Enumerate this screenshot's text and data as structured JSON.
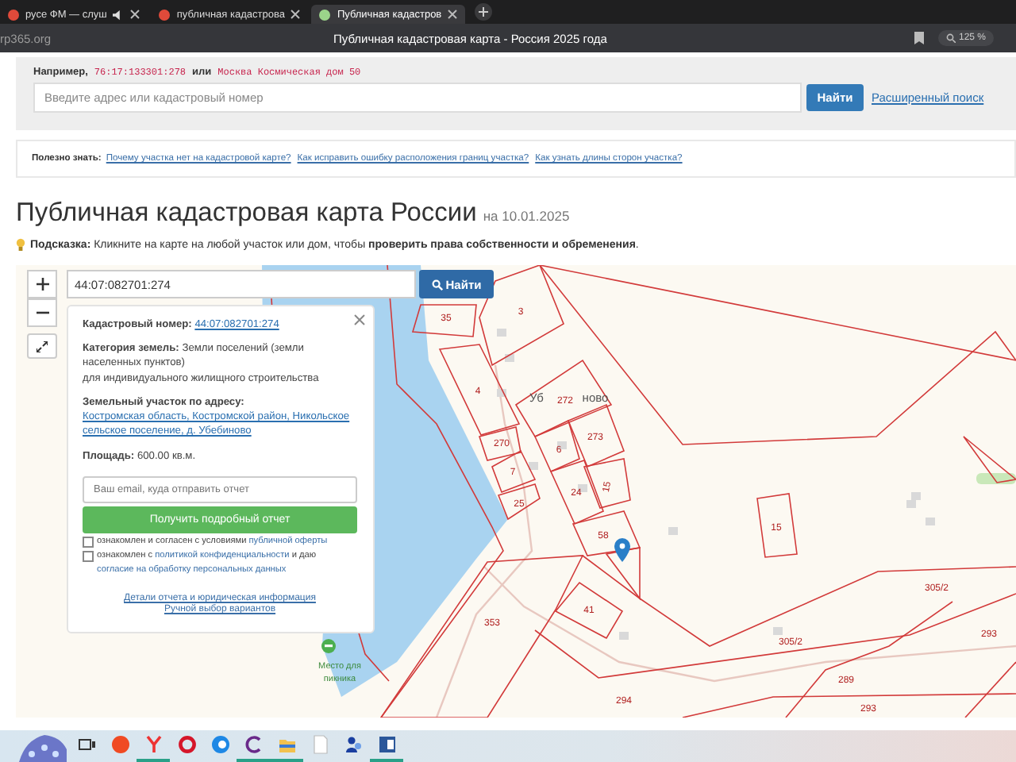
{
  "browser": {
    "tabs": [
      {
        "title": "русе ФМ — слуш",
        "audio": true,
        "selected": false
      },
      {
        "title": "публичная кадастрова",
        "audio": false,
        "selected": false
      },
      {
        "title": "Публичная кадастров",
        "audio": false,
        "selected": true
      }
    ],
    "address": "rp365.org",
    "page_title": "Публичная кадастровая карта - Россия 2025 года",
    "zoom": "125 %"
  },
  "search": {
    "example_label": "Например,",
    "example_1": "76:17:133301:278",
    "or": "или",
    "example_2": "Москва Космическая дом 50",
    "placeholder": "Введите адрес или кадастровый номер",
    "button": "Найти",
    "advanced_link": "Расширенный поиск"
  },
  "tips": {
    "label": "Полезно знать:",
    "links": [
      "Почему участка нет на кадастровой карте?",
      "Как исправить ошибку расположения границ участка?",
      "Как узнать длины сторон участка?"
    ]
  },
  "heading": {
    "title": "Публичная кадастровая карта России",
    "date": "на 10.01.2025"
  },
  "hint": "**Подсказка:** Кликните на карте на любой участок или дом, чтобы **проверить права собственности и обременения**.",
  "map": {
    "search_value": "44:07:082701:274",
    "search_button": "Найти",
    "parcel_labels": [
      "35",
      "3",
      "4",
      "272",
      "270",
      "273",
      "6",
      "7",
      "24",
      "15",
      "25",
      "58",
      "15",
      "305/2",
      "305/2",
      "353",
      "41",
      "293",
      "289",
      "293",
      "294"
    ],
    "village_label_parts": [
      "Уб",
      "ново"
    ],
    "poi_label": "Место для пикника",
    "popup": {
      "cadastral_label": "Кадастровый номер:",
      "cadastral_number": "44:07:082701:274",
      "category_label": "Категория земель:",
      "category": "Земли поселений (земли населенных пунктов)",
      "use": "для индивидуального жилищного строительства",
      "address_label": "Земельный участок по адресу:",
      "address": "Костромская область, Костромской район, Никольское сельское поселение, д. Убебиново",
      "area_label": "Площадь:",
      "area": "600.00 кв.м.",
      "email_placeholder": "Ваш email, куда отправить отчет",
      "report_button": "Получить подробный отчет",
      "consents": [
        {
          "checked": false,
          "parts": [
            {
              "kind": "plain",
              "text": "ознакомлен и согласен с условиями "
            },
            {
              "kind": "link",
              "text": "публичной оферты"
            }
          ]
        },
        {
          "checked": false,
          "parts": [
            {
              "kind": "plain",
              "text": "ознакомлен с "
            },
            {
              "kind": "link",
              "text": "политикой конфиденциальности"
            },
            {
              "kind": "plain",
              "text": " и даю "
            },
            {
              "kind": "link",
              "text": "согласие на обработку персональных данных"
            }
          ]
        }
      ],
      "links": [
        "Детали отчета и юридическая информация",
        "Ручной выбор вариантов"
      ]
    }
  },
  "taskbar": {
    "items": [
      {
        "kind": "task-view",
        "running": false
      },
      {
        "kind": "red-circle",
        "running": false
      },
      {
        "kind": "y-browser",
        "running": true
      },
      {
        "kind": "ring",
        "running": false
      },
      {
        "kind": "blue-circle",
        "running": false
      },
      {
        "kind": "c-app",
        "running": true
      },
      {
        "kind": "folder",
        "running": true
      },
      {
        "kind": "file",
        "running": false
      },
      {
        "kind": "people",
        "running": false
      },
      {
        "kind": "word",
        "running": true
      }
    ]
  }
}
